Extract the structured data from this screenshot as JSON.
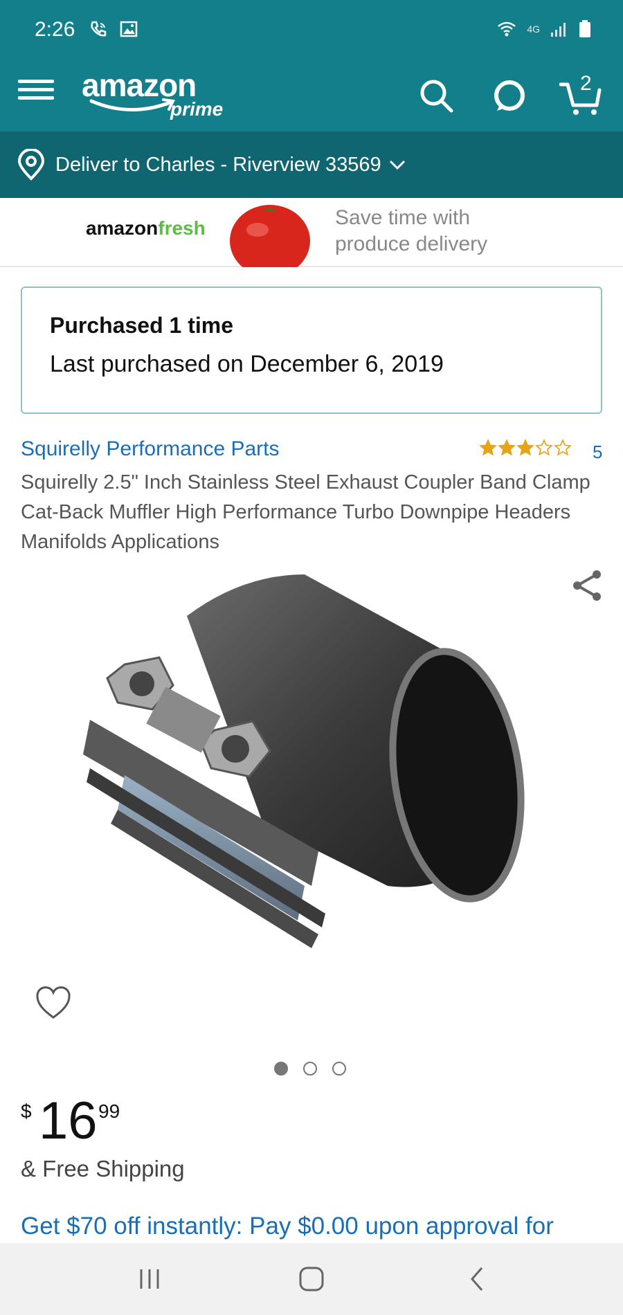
{
  "status_bar": {
    "time": "2:26",
    "network": "4G",
    "icons": [
      "call-icon",
      "image-icon",
      "wifi-icon",
      "signal-icon",
      "battery-icon"
    ]
  },
  "header": {
    "logo_word": "amazon",
    "logo_sub": "prime",
    "cart_count": "2",
    "icons": [
      "menu-icon",
      "search-icon",
      "alexa-icon",
      "cart-icon"
    ]
  },
  "delivery": {
    "label": "Deliver to Charles - Riverview 33569"
  },
  "fresh_banner": {
    "brand_a": "amazon",
    "brand_b": "fresh",
    "text": "Save time with produce delivery"
  },
  "purchase_history": {
    "count_text": "Purchased 1 time",
    "last_text": "Last purchased on December 6, 2019"
  },
  "product": {
    "brand": "Squirelly Performance Parts",
    "rating": 3,
    "rating_max": 5,
    "rating_count": "5",
    "title": "Squirelly 2.5\" Inch Stainless Steel Exhaust Coupler Band Clamp Cat-Back Muffler High Performance Turbo Downpipe Headers Manifolds Applications",
    "image_count": 3,
    "active_image": 1
  },
  "price": {
    "symbol": "$",
    "whole": "16",
    "fraction": "99",
    "shipping": "& Free Shipping"
  },
  "promo": {
    "text": "Get $70 off instantly: Pay $0.00 upon approval for"
  },
  "colors": {
    "header_bg": "#137f8b",
    "deliver_bg": "#0f6670",
    "link": "#1a6eb5",
    "star": "#e8a317"
  }
}
